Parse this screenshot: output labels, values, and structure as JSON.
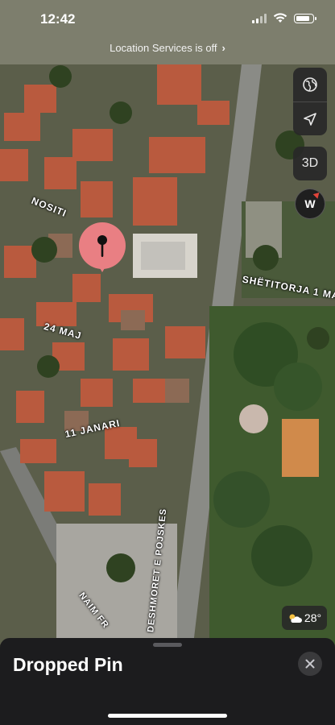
{
  "status_bar": {
    "time": "12:42"
  },
  "location_banner": {
    "text": "Location Services is off",
    "chevron": "›"
  },
  "map_controls": {
    "map_mode_icon": "globe-icon",
    "locate_icon": "location-arrow-icon",
    "three_d_label": "3D",
    "compass_label": "W"
  },
  "streets": {
    "nositi": "NOSITI",
    "maj24": "24 MAJ",
    "janari11": "11 JANARI",
    "shetitorja": "SHËTITORJA 1 MA",
    "deshmoret": "DESHMORET E POJSKES",
    "naim": "NAIM FR"
  },
  "weather": {
    "icon": "partly-sunny-icon",
    "temp": "28°"
  },
  "sheet": {
    "title": "Dropped Pin",
    "close_icon": "close-icon"
  },
  "colors": {
    "pin": "#e97f83",
    "sheet_bg": "#1c1c1e",
    "control_bg": "#282828"
  }
}
